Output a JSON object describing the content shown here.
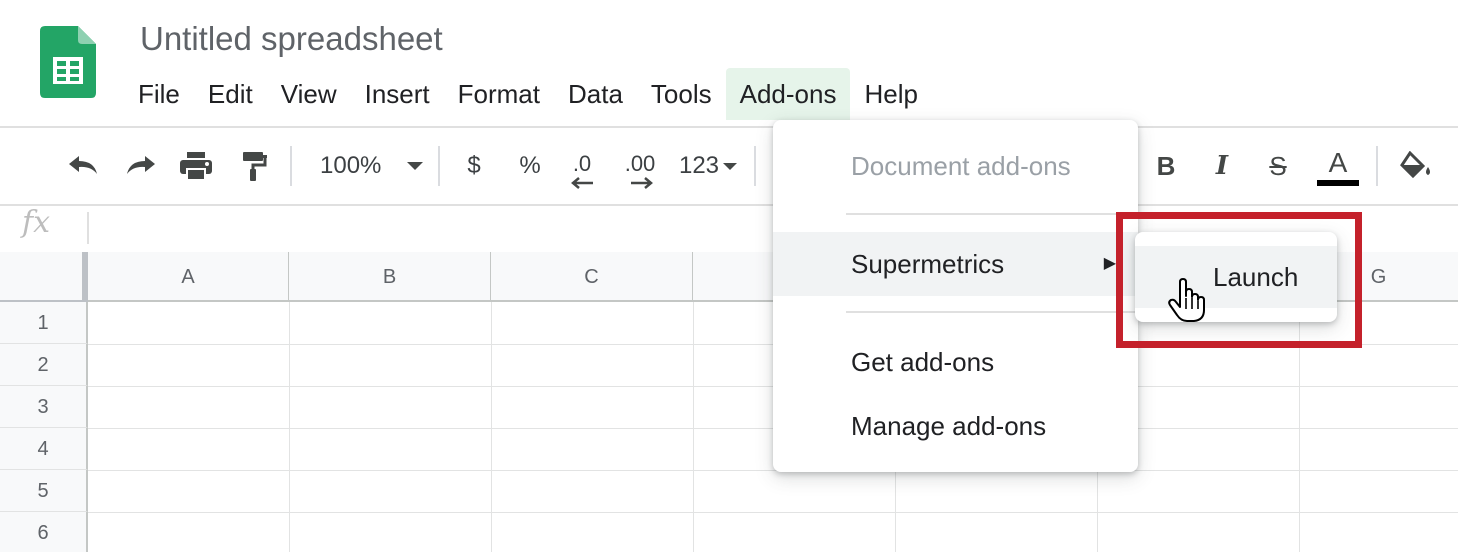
{
  "app": {
    "title": "Untitled spreadsheet",
    "logo_icon": "google-sheets-logo-icon",
    "brand_color": "#23a566"
  },
  "menubar": {
    "items": [
      "File",
      "Edit",
      "View",
      "Insert",
      "Format",
      "Data",
      "Tools",
      "Add-ons",
      "Help"
    ],
    "active": "Add-ons"
  },
  "toolbar": {
    "undo_icon": "undo-icon",
    "redo_icon": "redo-icon",
    "print_icon": "print-icon",
    "paint_format_icon": "paint-format-icon",
    "zoom": "100%",
    "currency": "$",
    "percent": "%",
    "decrease_decimal": ".0",
    "increase_decimal": ".00",
    "more_formats": "123",
    "bold": "B",
    "italic": "I",
    "strikethrough": "S",
    "text_color": "A",
    "text_color_bar": "#000000",
    "fill_icon": "fill-color-icon"
  },
  "formula_bar": {
    "label": "fx",
    "value": ""
  },
  "grid": {
    "columns": [
      "A",
      "B",
      "C",
      "G"
    ],
    "rows": [
      "1",
      "2",
      "3",
      "4",
      "5",
      "6"
    ]
  },
  "addons_menu": {
    "header": "Document add-ons",
    "supermetrics": "Supermetrics",
    "get_addons": "Get add-ons",
    "manage_addons": "Manage add-ons",
    "submenu_arrow": "▶"
  },
  "submenu": {
    "launch": "Launch"
  },
  "annotation": {
    "highlight_color": "#c4212b"
  }
}
